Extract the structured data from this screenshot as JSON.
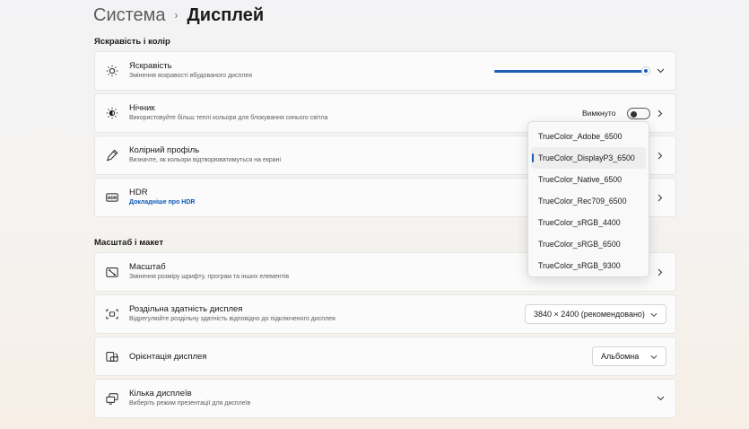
{
  "breadcrumb": {
    "parent": "Система",
    "separator": "›",
    "current": "Дисплей"
  },
  "sections": {
    "brightness_color": "Яскравість і колір",
    "scale_layout": "Масштаб і макет"
  },
  "cards": {
    "brightness": {
      "title": "Яскравість",
      "subtitle": "Змінення яскравості вбудованого дисплея",
      "icon": "sun-icon",
      "value_percent": 98
    },
    "night_light": {
      "title": "Нічник",
      "subtitle": "Використовуйте більш теплі кольори для блокування синього світла",
      "icon": "night-light-icon",
      "toggle_label": "Вимкнуто",
      "toggle_on": false
    },
    "color_profile": {
      "title": "Колірний профіль",
      "subtitle": "Визначте, як кольори відтворюватимуться на екрані",
      "icon": "pen-icon"
    },
    "hdr": {
      "title": "HDR",
      "link": "Докладніше про HDR",
      "icon": "hdr-icon"
    },
    "scale": {
      "title": "Масштаб",
      "subtitle": "Змінення розміру шрифту, програм та інших елементів",
      "icon": "scale-icon"
    },
    "resolution": {
      "title": "Роздільна здатність дисплея",
      "subtitle": "Відрегулюйте роздільну здатність відповідно до  підключеного дисплея",
      "icon": "resolution-icon",
      "value": "3840 × 2400 (рекомендовано)"
    },
    "orientation": {
      "title": "Орієнтація дисплея",
      "icon": "orientation-icon",
      "value": "Альбомна"
    },
    "multiple": {
      "title": "Кілька дисплеїв",
      "subtitle": "Виберіть режим презентації для дисплеїв",
      "icon": "multiple-displays-icon"
    }
  },
  "color_profile_dropdown": {
    "selected_index": 1,
    "options": [
      "TrueColor_Adobe_6500",
      "TrueColor_DisplayP3_6500",
      "TrueColor_Native_6500",
      "TrueColor_Rec709_6500",
      "TrueColor_sRGB_4400",
      "TrueColor_sRGB_6500",
      "TrueColor_sRGB_9300"
    ]
  },
  "colors": {
    "accent": "#1d5fb3",
    "link": "#0a58b5"
  }
}
